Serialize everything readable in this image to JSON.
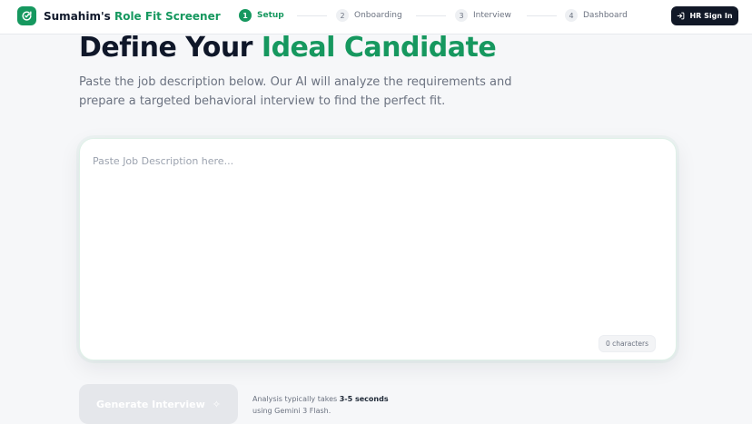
{
  "header": {
    "brand_prefix": "Sumahim's",
    "brand_accent": "Role Fit Screener",
    "steps": [
      {
        "num": "1",
        "label": "Setup",
        "active": true
      },
      {
        "num": "2",
        "label": "Onboarding",
        "active": false
      },
      {
        "num": "3",
        "label": "Interview",
        "active": false
      },
      {
        "num": "4",
        "label": "Dashboard",
        "active": false
      }
    ],
    "signin_label": "HR Sign In"
  },
  "main": {
    "title_prefix": "Define Your",
    "title_accent": "Ideal Candidate",
    "subtitle": "Paste the job description below. Our AI will analyze the requirements and prepare a targeted behavioral interview to find the perfect fit.",
    "jd_input": {
      "value": "",
      "placeholder": "Paste Job Description here..."
    },
    "char_count": "0 characters",
    "generate_label": "Generate Interview",
    "note_prefix": "Analysis typically takes",
    "note_bold": "3-5 seconds",
    "note_suffix": "using Gemini 3 Flash."
  },
  "colors": {
    "accent": "#16985f",
    "dark_button": "#111827",
    "disabled_button": "#e5e7eb"
  },
  "icons": {
    "logo": "refresh-check-icon",
    "signin": "sign-in-arrow-icon",
    "generate": "sparkle-icon"
  }
}
